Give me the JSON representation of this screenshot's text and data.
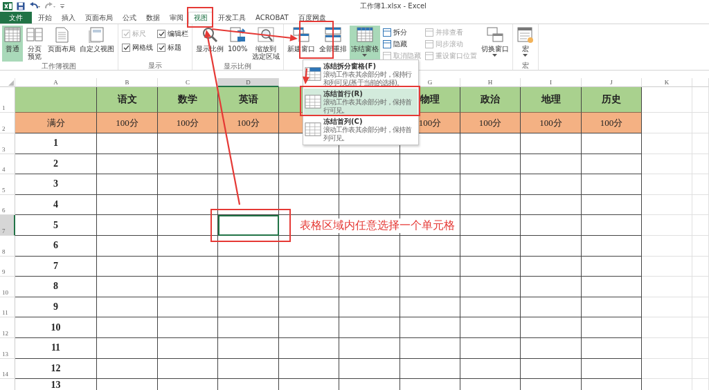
{
  "window": {
    "title": "工作簿1.xlsx - Excel"
  },
  "ribbon_tabs": [
    {
      "label": "文件",
      "kind": "file",
      "selected": false
    },
    {
      "label": "开始",
      "kind": "tab",
      "selected": false
    },
    {
      "label": "插入",
      "kind": "tab",
      "selected": false
    },
    {
      "label": "页面布局",
      "kind": "tab",
      "selected": false
    },
    {
      "label": "公式",
      "kind": "tab",
      "selected": false
    },
    {
      "label": "数据",
      "kind": "tab",
      "selected": false
    },
    {
      "label": "审阅",
      "kind": "tab",
      "selected": false
    },
    {
      "label": "视图",
      "kind": "tab",
      "selected": true
    },
    {
      "label": "开发工具",
      "kind": "tab",
      "selected": false
    },
    {
      "label": "ACROBAT",
      "kind": "tab",
      "selected": false
    },
    {
      "label": "百度网盘",
      "kind": "tab",
      "selected": false
    }
  ],
  "ribbon_groups": [
    {
      "label": "工作簿视图",
      "items": [
        {
          "kind": "large",
          "label": "普通",
          "selected": true
        },
        {
          "kind": "large",
          "label": [
            "分页",
            "预览"
          ],
          "selected": false
        },
        {
          "kind": "large",
          "label": "页面布局",
          "selected": false
        },
        {
          "kind": "large",
          "label": "自定义视图",
          "selected": false
        }
      ]
    },
    {
      "label": "显示",
      "items": [
        {
          "kind": "column",
          "items": [
            {
              "kind": "check",
              "label": "标尺",
              "checked": true,
              "disabled": true
            },
            {
              "kind": "check",
              "label": "网格线",
              "checked": true,
              "disabled": false
            }
          ]
        },
        {
          "kind": "column",
          "items": [
            {
              "kind": "check",
              "label": "编辑栏",
              "checked": true,
              "disabled": false
            },
            {
              "kind": "check",
              "label": "标题",
              "checked": true,
              "disabled": false
            }
          ]
        }
      ]
    },
    {
      "label": "显示比例",
      "items": [
        {
          "kind": "large",
          "label": "显示比例",
          "selected": false
        },
        {
          "kind": "large",
          "label": "100%",
          "selected": false
        },
        {
          "kind": "large",
          "label": [
            "缩放到",
            "选定区域"
          ],
          "selected": false
        }
      ]
    },
    {
      "items": [
        {
          "kind": "large",
          "label": "新建窗口",
          "selected": false
        },
        {
          "kind": "large",
          "label": "全部重排",
          "selected": false
        },
        {
          "kind": "large",
          "label": "冻结窗格",
          "selected": true,
          "has_menu": true
        },
        {
          "kind": "column",
          "items": [
            {
              "kind": "small",
              "label": "拆分",
              "disabled": false
            },
            {
              "kind": "small",
              "label": "隐藏",
              "disabled": false
            },
            {
              "kind": "small",
              "label": "取消隐藏",
              "disabled": true
            }
          ]
        },
        {
          "kind": "column",
          "items": [
            {
              "kind": "small",
              "label": "并排查看",
              "disabled": true
            },
            {
              "kind": "small",
              "label": "同步滚动",
              "disabled": true
            },
            {
              "kind": "small",
              "label": "重设窗口位置",
              "disabled": true
            }
          ]
        },
        {
          "kind": "large",
          "label": "切换窗口",
          "selected": false,
          "has_menu": true
        }
      ]
    },
    {
      "label": "宏",
      "items": [
        {
          "kind": "large",
          "label": "宏",
          "selected": false,
          "has_menu": true
        }
      ]
    }
  ],
  "dropdown": {
    "items": [
      {
        "title": "冻结拆分窗格(F)",
        "description": "滚动工作表其余部分时，保持行和列可见(基于当前的选择)。",
        "selected": false
      },
      {
        "title": "冻结首行(R)",
        "description": "滚动工作表其余部分时，保持首行可见。",
        "selected": true
      },
      {
        "title": "冻结首列(C)",
        "description": "滚动工作表其余部分时，保持首列可见。",
        "selected": false
      }
    ]
  },
  "sheet": {
    "columns": [
      {
        "label": "A",
        "selected": false
      },
      {
        "label": "B",
        "selected": false
      },
      {
        "label": "C",
        "selected": false
      },
      {
        "label": "D",
        "selected": true
      },
      {},
      {},
      {
        "label": "G",
        "selected": false
      },
      {
        "label": "H",
        "selected": false
      },
      {
        "label": "I",
        "selected": false
      },
      {
        "label": "J",
        "selected": false
      },
      {
        "label": "K",
        "selected": false
      }
    ],
    "rows": [
      {
        "number": "1",
        "kind": "subject",
        "selected": false,
        "cells": [
          null,
          "语文",
          "数学",
          "英语",
          null,
          null,
          "物理",
          "政治",
          "地理",
          "历史",
          null
        ]
      },
      {
        "number": "2",
        "kind": "score",
        "selected": false,
        "cells": [
          "满分",
          "100分",
          "100分",
          "100分",
          null,
          null,
          "100分",
          "100分",
          "100分",
          "100分",
          null
        ]
      },
      {
        "number": "3",
        "kind": "plain",
        "selected": false,
        "cells": [
          "1"
        ]
      },
      {
        "number": "4",
        "kind": "plain",
        "selected": false,
        "cells": [
          "2"
        ]
      },
      {
        "number": "5",
        "kind": "plain",
        "selected": false,
        "cells": [
          "3"
        ]
      },
      {
        "number": "6",
        "kind": "plain",
        "selected": false,
        "cells": [
          "4"
        ]
      },
      {
        "number": "7",
        "kind": "plain",
        "selected": true,
        "cells": [
          "5"
        ]
      },
      {
        "number": "8",
        "kind": "plain",
        "selected": false,
        "cells": [
          "6"
        ]
      },
      {
        "number": "9",
        "kind": "plain",
        "selected": false,
        "cells": [
          "7"
        ]
      },
      {
        "number": "10",
        "kind": "plain",
        "selected": false,
        "cells": [
          "8"
        ]
      },
      {
        "number": "11",
        "kind": "plain",
        "selected": false,
        "cells": [
          "9"
        ]
      },
      {
        "number": "12",
        "kind": "plain",
        "selected": false,
        "cells": [
          "10"
        ]
      },
      {
        "number": "13",
        "kind": "plain",
        "selected": false,
        "cells": [
          "11"
        ]
      },
      {
        "number": "14",
        "kind": "plain",
        "selected": false,
        "cells": [
          "12"
        ]
      },
      {
        "kind": "plain",
        "selected": false,
        "cells": [
          "13"
        ]
      }
    ]
  },
  "annotation_text": "表格区域内任意选择一个单元格"
}
